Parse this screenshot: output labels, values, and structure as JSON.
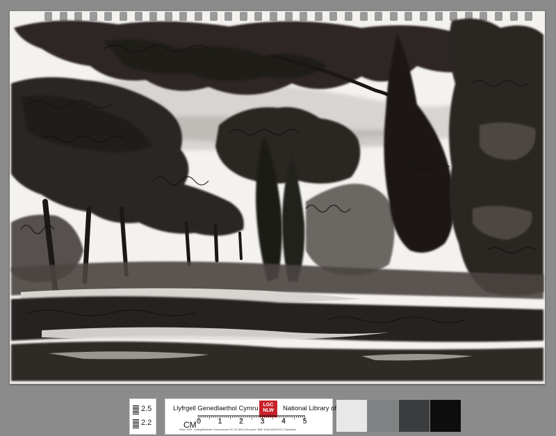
{
  "image": {
    "subject": "ink-wash-landscape-sketch",
    "palette": {
      "sheet": "#f4f2ef",
      "ink": "#2b2624",
      "wash": "#6e6864",
      "background": "#8b8b8b"
    }
  },
  "scale_card": {
    "top_value": "2.5",
    "bottom_value": "2.2"
  },
  "library_card": {
    "welsh_name": "Llyfrgell Genedlaethol Cymru",
    "logo_top": "LGC",
    "logo_bottom": "NLW",
    "english_name": "National Library of Wales",
    "ruler_unit": "CM",
    "ruler_numbers": [
      "0",
      "1",
      "2",
      "3",
      "4",
      "5"
    ],
    "fine_print": "Patch 1195 - Gridsg/Medeolth Colourchecker DC (11 NBC) Res patch: NBE 1016a ANSI/ISO 2 Equivalent"
  },
  "color_patches": [
    "#e8e8e8",
    "#7f8183",
    "#3a3c3e",
    "#0d0d0d"
  ]
}
